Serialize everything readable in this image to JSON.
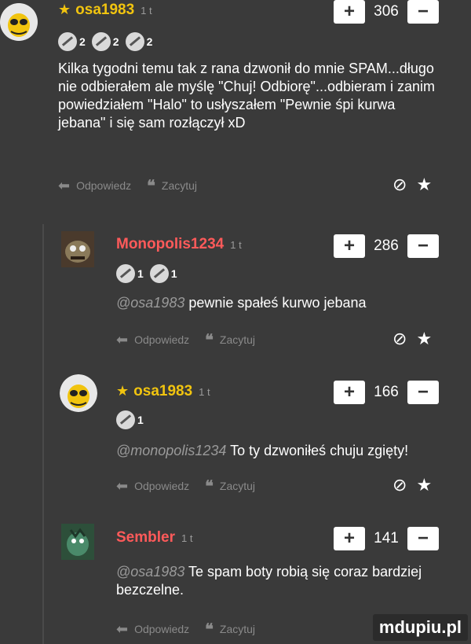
{
  "comments": [
    {
      "author": "osa1983",
      "time": "1 t",
      "votes": "306",
      "badges": [
        "2",
        "2",
        "2"
      ],
      "text": "Kilka tygodni temu tak z rana dzwonił do mnie SPAM...długo nie odbierałem ale myślę \"Chuj! Odbiorę\"...odbieram i zanim powiedziałem \"Halo\" to usłyszałem \"Pewnie śpi kurwa jebana\" i się sam rozłączył xD",
      "reply": "Odpowiedz",
      "quote": "Zacytuj"
    },
    {
      "author": "Monopolis1234",
      "time": "1 t",
      "votes": "286",
      "badges": [
        "1",
        "1"
      ],
      "mention": "@osa1983",
      "text": "pewnie spałeś kurwo jebana",
      "reply": "Odpowiedz",
      "quote": "Zacytuj"
    },
    {
      "author": "osa1983",
      "time": "1 t",
      "votes": "166",
      "badges": [
        "1"
      ],
      "mention": "@monopolis1234",
      "text": "To ty dzwoniłeś chuju zgięty!",
      "reply": "Odpowiedz",
      "quote": "Zacytuj"
    },
    {
      "author": "Sembler",
      "time": "1 t",
      "votes": "141",
      "mention": "@osa1983",
      "text": "Te spam boty robią się coraz bardziej bezczelne.",
      "reply": "Odpowiedz",
      "quote": "Zacytuj"
    }
  ],
  "vote_labels": {
    "plus": "+",
    "minus": "−"
  },
  "watermark": "mdupiu.pl",
  "colors": {
    "author_yellow": "#f1c40f",
    "author_red": "#ff5a5a",
    "background": "#3a3a3a"
  },
  "icons": [
    "reply-arrow-icon",
    "quote-icon",
    "report-icon",
    "star-icon",
    "badge-icon"
  ]
}
